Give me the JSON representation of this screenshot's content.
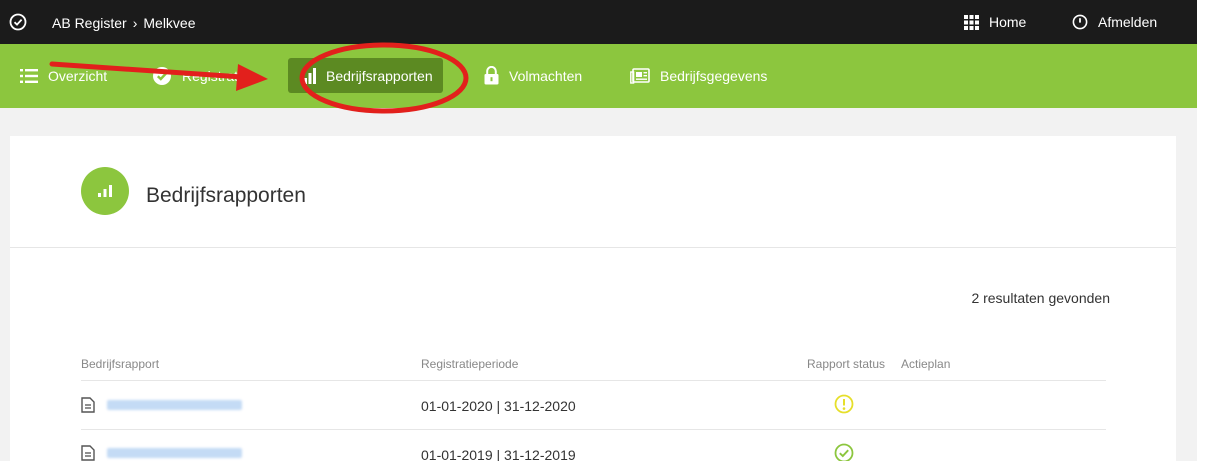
{
  "topbar": {
    "logo_icon": "check-circle-icon",
    "breadcrumb": [
      "AB Register",
      "Melkvee"
    ],
    "home_label": "Home",
    "logout_label": "Afmelden"
  },
  "nav": {
    "items": [
      {
        "label": "Overzicht",
        "icon": "list-icon"
      },
      {
        "label": "Registraties",
        "icon": "check-circle-icon"
      },
      {
        "label": "Bedrijfsrapporten",
        "icon": "bar-chart-icon",
        "active": true
      },
      {
        "label": "Volmachten",
        "icon": "lock-icon"
      },
      {
        "label": "Bedrijfsgegevens",
        "icon": "id-card-icon"
      }
    ]
  },
  "page": {
    "title": "Bedrijfsrapporten",
    "results_text": "2 resultaten gevonden"
  },
  "table": {
    "headers": [
      "Bedrijfsrapport",
      "Registratieperiode",
      "Rapport status",
      "Actieplan"
    ],
    "rows": [
      {
        "period": "01-01-2020 | 31-12-2020",
        "status": "warning"
      },
      {
        "period": "01-01-2019 | 31-12-2019",
        "status": "ok"
      }
    ]
  },
  "colors": {
    "brand_green": "#8cc63e",
    "active_green": "#5c8a22",
    "topbar": "#1b1b1b",
    "annotation_red": "#e2201c",
    "status_warning": "#e6df2a",
    "status_ok": "#8cc63e"
  }
}
